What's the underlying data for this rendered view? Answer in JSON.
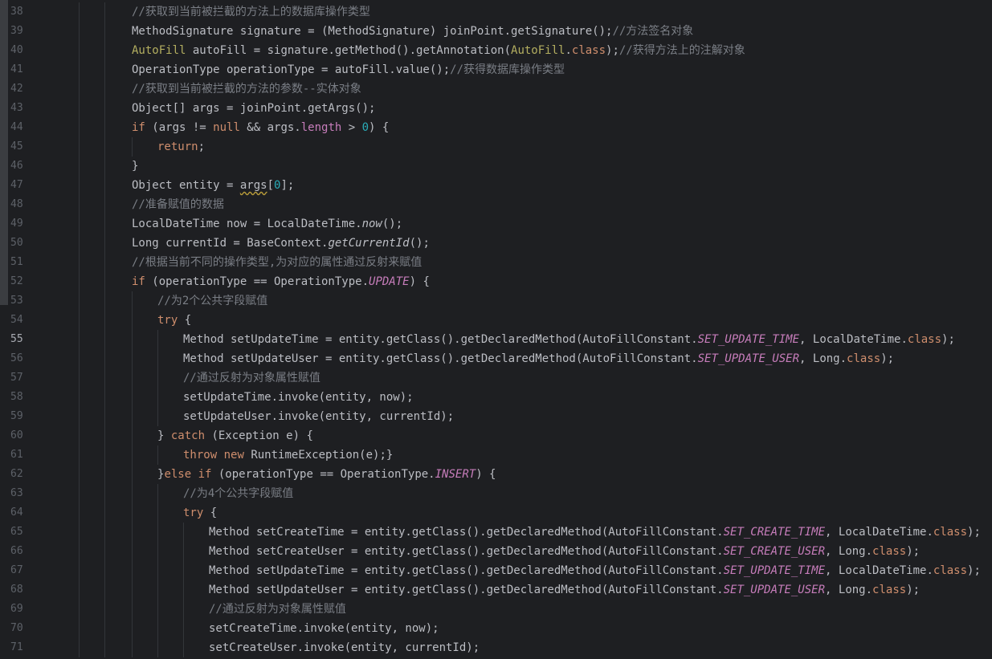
{
  "editor": {
    "lines": [
      {
        "no": "38",
        "indent": 164,
        "tokens": [
          {
            "t": "//获取到当前被拦截的方法上的数据库操作类型",
            "c": "com"
          }
        ]
      },
      {
        "no": "39",
        "indent": 164,
        "tokens": [
          {
            "t": "MethodSignature signature = (MethodSignature) joinPoint.getSignature();"
          },
          {
            "t": "//方法签名对象",
            "c": "com"
          }
        ]
      },
      {
        "no": "40",
        "indent": 164,
        "tokens": [
          {
            "t": "AutoFill",
            "c": "ann"
          },
          {
            "t": " autoFill = signature.getMethod().getAnnotation("
          },
          {
            "t": "AutoFill",
            "c": "ann"
          },
          {
            "t": "."
          },
          {
            "t": "class",
            "c": "kw"
          },
          {
            "t": ");"
          },
          {
            "t": "//获得方法上的注解对象",
            "c": "com"
          }
        ]
      },
      {
        "no": "41",
        "indent": 164,
        "tokens": [
          {
            "t": "OperationType operationType = autoFill.value();"
          },
          {
            "t": "//获得数据库操作类型",
            "c": "com"
          }
        ]
      },
      {
        "no": "42",
        "indent": 164,
        "tokens": [
          {
            "t": "//获取到当前被拦截的方法的参数--实体对象",
            "c": "com"
          }
        ]
      },
      {
        "no": "43",
        "indent": 164,
        "tokens": [
          {
            "t": "Object[] args = joinPoint.getArgs();"
          }
        ]
      },
      {
        "no": "44",
        "indent": 164,
        "tokens": [
          {
            "t": "if",
            "c": "kw"
          },
          {
            "t": " (args != "
          },
          {
            "t": "null",
            "c": "kw"
          },
          {
            "t": " && args."
          },
          {
            "t": "length",
            "c": "fld"
          },
          {
            "t": " > "
          },
          {
            "t": "0",
            "c": "num"
          },
          {
            "t": ") {"
          }
        ]
      },
      {
        "no": "45",
        "indent": 196,
        "tokens": [
          {
            "t": "return",
            "c": "kw"
          },
          {
            "t": ";"
          }
        ]
      },
      {
        "no": "46",
        "indent": 164,
        "tokens": [
          {
            "t": "}"
          }
        ]
      },
      {
        "no": "47",
        "indent": 164,
        "tokens": [
          {
            "t": "Object entity = "
          },
          {
            "t": "args",
            "c": "warn"
          },
          {
            "t": "["
          },
          {
            "t": "0",
            "c": "num"
          },
          {
            "t": "];"
          }
        ]
      },
      {
        "no": "48",
        "indent": 164,
        "tokens": [
          {
            "t": "//准备赋值的数据",
            "c": "com"
          }
        ]
      },
      {
        "no": "49",
        "indent": 164,
        "tokens": [
          {
            "t": "LocalDateTime now = LocalDateTime."
          },
          {
            "t": "now",
            "c": "ital"
          },
          {
            "t": "();"
          }
        ]
      },
      {
        "no": "50",
        "indent": 164,
        "tokens": [
          {
            "t": "Long currentId = BaseContext."
          },
          {
            "t": "getCurrentId",
            "c": "ital"
          },
          {
            "t": "();"
          }
        ]
      },
      {
        "no": "51",
        "indent": 164,
        "tokens": [
          {
            "t": "//根据当前不同的操作类型,为对应的属性通过反射来赋值",
            "c": "com"
          }
        ]
      },
      {
        "no": "52",
        "indent": 164,
        "tokens": [
          {
            "t": "if",
            "c": "kw"
          },
          {
            "t": " (operationType == OperationType."
          },
          {
            "t": "UPDATE",
            "c": "cst"
          },
          {
            "t": ") {"
          }
        ]
      },
      {
        "no": "53",
        "indent": 196,
        "tokens": [
          {
            "t": "//为2个公共字段赋值",
            "c": "com"
          }
        ]
      },
      {
        "no": "54",
        "indent": 196,
        "tokens": [
          {
            "t": "try",
            "c": "kw"
          },
          {
            "t": " {"
          }
        ]
      },
      {
        "no": "55",
        "indent": 228,
        "tokens": [
          {
            "t": "Method setUpdateTime = entity.getClass().getDeclaredMethod(AutoFillConstant."
          },
          {
            "t": "SET_UPDATE_TIME",
            "c": "cst"
          },
          {
            "t": ", LocalDateTime."
          },
          {
            "t": "class",
            "c": "kw"
          },
          {
            "t": ");"
          }
        ]
      },
      {
        "no": "56",
        "indent": 228,
        "tokens": [
          {
            "t": "Method setUpdateUser = entity.getClass().getDeclaredMethod(AutoFillConstant."
          },
          {
            "t": "SET_UPDATE_USER",
            "c": "cst"
          },
          {
            "t": ", Long."
          },
          {
            "t": "class",
            "c": "kw"
          },
          {
            "t": ");"
          }
        ]
      },
      {
        "no": "57",
        "indent": 228,
        "tokens": [
          {
            "t": "//通过反射为对象属性赋值",
            "c": "com"
          }
        ]
      },
      {
        "no": "58",
        "indent": 228,
        "tokens": [
          {
            "t": "setUpdateTime.invoke(entity, now);"
          }
        ]
      },
      {
        "no": "59",
        "indent": 228,
        "tokens": [
          {
            "t": "setUpdateUser.invoke(entity, currentId);"
          }
        ]
      },
      {
        "no": "60",
        "indent": 196,
        "tokens": [
          {
            "t": "} "
          },
          {
            "t": "catch",
            "c": "kw"
          },
          {
            "t": " (Exception e) {"
          }
        ]
      },
      {
        "no": "61",
        "indent": 228,
        "tokens": [
          {
            "t": "throw",
            "c": "kw"
          },
          {
            "t": " "
          },
          {
            "t": "new",
            "c": "kw"
          },
          {
            "t": " RuntimeException(e);}"
          }
        ]
      },
      {
        "no": "62",
        "indent": 196,
        "tokens": [
          {
            "t": "}"
          },
          {
            "t": "else",
            "c": "kw"
          },
          {
            "t": " "
          },
          {
            "t": "if",
            "c": "kw"
          },
          {
            "t": " (operationType == OperationType."
          },
          {
            "t": "INSERT",
            "c": "cst"
          },
          {
            "t": ") {"
          }
        ]
      },
      {
        "no": "63",
        "indent": 228,
        "tokens": [
          {
            "t": "//为4个公共字段赋值",
            "c": "com"
          }
        ]
      },
      {
        "no": "64",
        "indent": 228,
        "tokens": [
          {
            "t": "try",
            "c": "kw"
          },
          {
            "t": " {"
          }
        ]
      },
      {
        "no": "65",
        "indent": 260,
        "tokens": [
          {
            "t": "Method setCreateTime = entity.getClass().getDeclaredMethod(AutoFillConstant."
          },
          {
            "t": "SET_CREATE_TIME",
            "c": "cst"
          },
          {
            "t": ", LocalDateTime."
          },
          {
            "t": "class",
            "c": "kw"
          },
          {
            "t": ");"
          }
        ]
      },
      {
        "no": "66",
        "indent": 260,
        "tokens": [
          {
            "t": "Method setCreateUser = entity.getClass().getDeclaredMethod(AutoFillConstant."
          },
          {
            "t": "SET_CREATE_USER",
            "c": "cst"
          },
          {
            "t": ", Long."
          },
          {
            "t": "class",
            "c": "kw"
          },
          {
            "t": ");"
          }
        ]
      },
      {
        "no": "67",
        "indent": 260,
        "tokens": [
          {
            "t": "Method setUpdateTime = entity.getClass().getDeclaredMethod(AutoFillConstant."
          },
          {
            "t": "SET_UPDATE_TIME",
            "c": "cst"
          },
          {
            "t": ", LocalDateTime."
          },
          {
            "t": "class",
            "c": "kw"
          },
          {
            "t": ");"
          }
        ]
      },
      {
        "no": "68",
        "indent": 260,
        "tokens": [
          {
            "t": "Method setUpdateUser = entity.getClass().getDeclaredMethod(AutoFillConstant."
          },
          {
            "t": "SET_UPDATE_USER",
            "c": "cst"
          },
          {
            "t": ", Long."
          },
          {
            "t": "class",
            "c": "kw"
          },
          {
            "t": ");"
          }
        ]
      },
      {
        "no": "69",
        "indent": 260,
        "tokens": [
          {
            "t": "//通过反射为对象属性赋值",
            "c": "com"
          }
        ]
      },
      {
        "no": "70",
        "indent": 260,
        "tokens": [
          {
            "t": "setCreateTime.invoke(entity, now);"
          }
        ]
      },
      {
        "no": "71",
        "indent": 260,
        "tokens": [
          {
            "t": "setCreateUser.invoke(entity, currentId);"
          }
        ]
      }
    ],
    "current_line": "55"
  },
  "colors": {
    "background": "#1e1f22",
    "text": "#bcbec4",
    "keyword": "#cf8e6d",
    "annotation": "#b3ae60",
    "comment": "#7a7e85",
    "number": "#2aacb8",
    "constant": "#c77dbb",
    "line_number": "#5d6168"
  }
}
